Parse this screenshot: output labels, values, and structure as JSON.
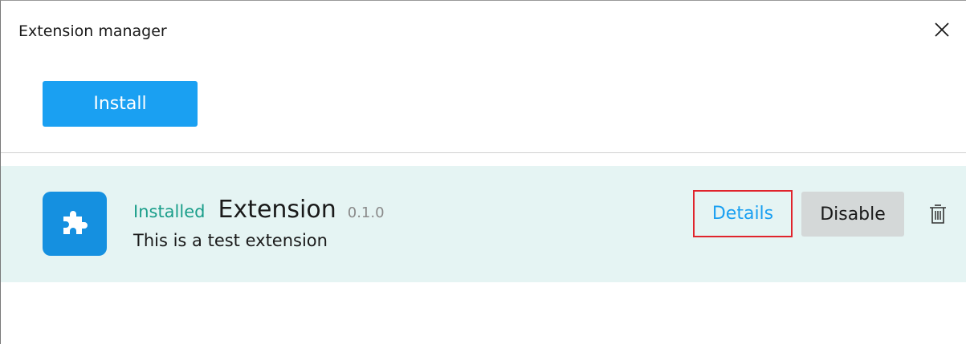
{
  "window": {
    "title": "Extension manager"
  },
  "toolbar": {
    "install_label": "Install"
  },
  "extensions": [
    {
      "status": "Installed",
      "name": "Extension",
      "version": "0.1.0",
      "description": "This is a test extension",
      "icon": "puzzle-piece-icon",
      "details_label": "Details",
      "disable_label": "Disable",
      "delete_icon": "trash-icon"
    }
  ],
  "colors": {
    "accent": "#1aa0f2",
    "installed_status": "#1a9e8a",
    "row_background": "#e5f4f3",
    "icon_background": "#1590e0",
    "highlight_border": "#e0242c",
    "disable_button": "#d4d8d8"
  }
}
